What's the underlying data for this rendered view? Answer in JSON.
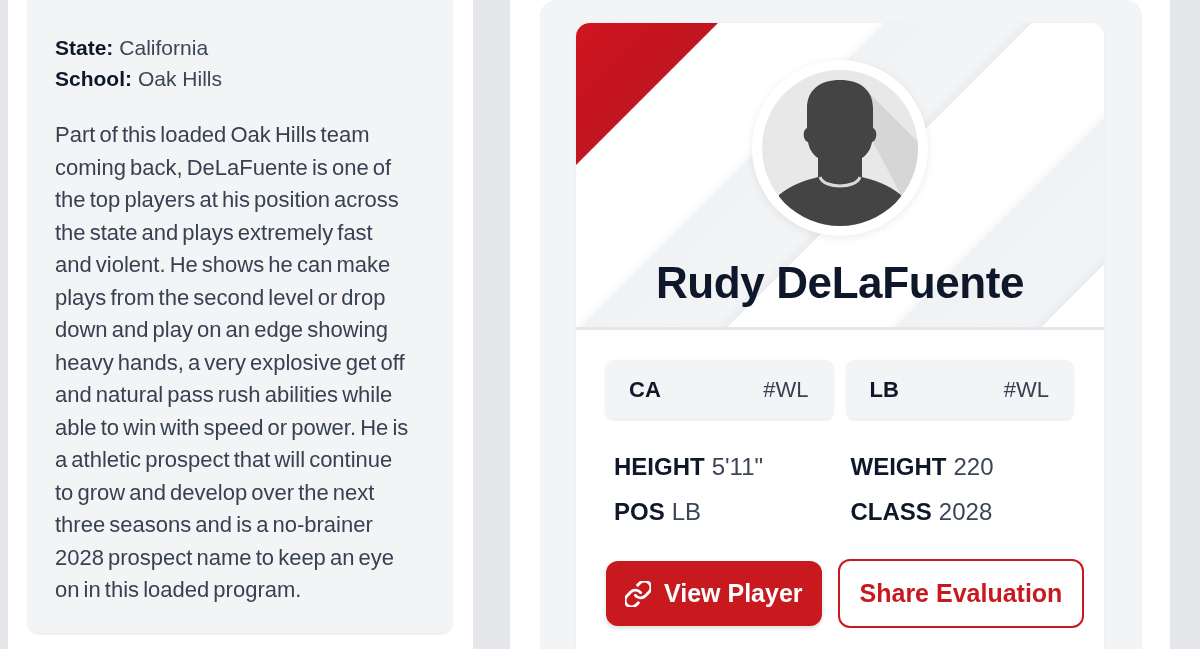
{
  "bio_card": {
    "fields": [
      {
        "label": "State:",
        "value": "California"
      },
      {
        "label": "School:",
        "value": "Oak Hills"
      }
    ],
    "description": "Part of this loaded Oak Hills team coming back, DeLaFuente is one of the top players at his position across the state and plays extremely fast and violent. He shows he can make plays from the second level or drop down and play on an edge showing heavy hands, a very explosive get off and natural pass rush abilities while able to win with speed or power. He is a athletic prospect that will continue to grow and develop over the next three seasons and is a no-brainer 2028 prospect name to keep an eye on in this loaded program."
  },
  "player_card": {
    "name": "Rudy DeLaFuente",
    "rankings": [
      {
        "label": "CA",
        "value": "#WL"
      },
      {
        "label": "LB",
        "value": "#WL"
      }
    ],
    "stats": [
      {
        "label": "HEIGHT",
        "value": "5'11\""
      },
      {
        "label": "WEIGHT",
        "value": "220"
      },
      {
        "label": "POS",
        "value": "LB"
      },
      {
        "label": "CLASS",
        "value": "2028"
      }
    ],
    "buttons": [
      {
        "label": "View Player",
        "kind": "primary"
      },
      {
        "label": "Share Evaluation",
        "kind": "outline"
      }
    ]
  }
}
